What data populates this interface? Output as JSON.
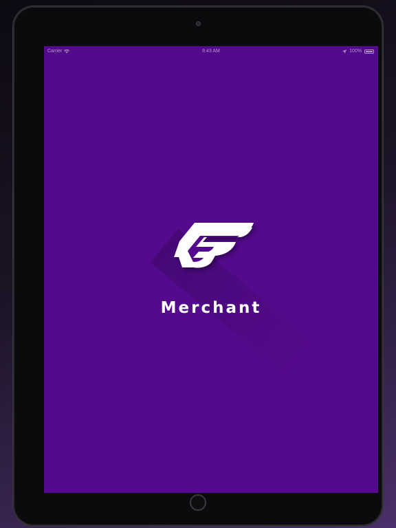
{
  "status_bar": {
    "carrier": "Carrier",
    "time": "8:43 AM",
    "battery": "100%",
    "battery_level": 1.0,
    "icons": [
      "wifi-icon",
      "location-arrow-icon",
      "battery-icon"
    ]
  },
  "splash": {
    "app_name": "Merchant",
    "logo": "f-wing-logo"
  },
  "colors": {
    "background": "#540a8c",
    "text": "#ffffff",
    "bezel": "#0b0b0d"
  }
}
